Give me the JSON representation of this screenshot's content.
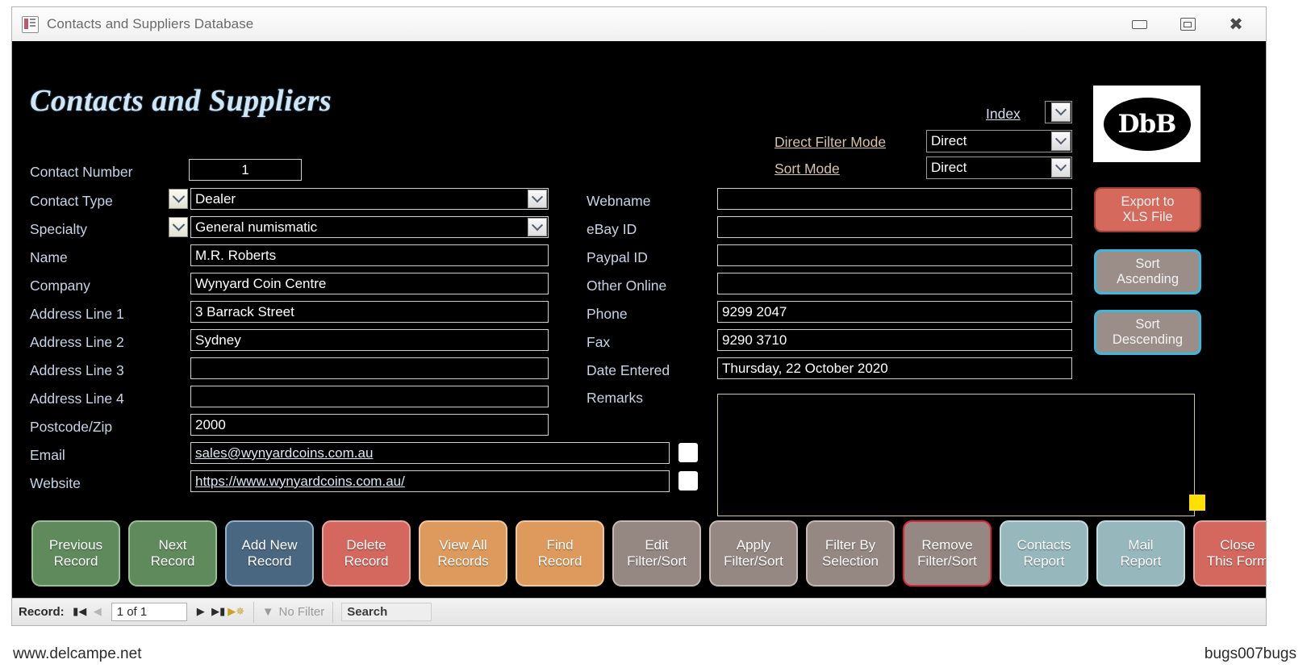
{
  "window": {
    "title": "Contacts and Suppliers Database",
    "icon": "access-form-icon",
    "controls": {
      "minimize": "–",
      "restore": "▣",
      "close": "✕"
    }
  },
  "form": {
    "title": "Contacts and Suppliers",
    "logo_text": "DbB",
    "top_controls": {
      "index_label": "Index",
      "index_value": "",
      "direct_filter_mode_label": "Direct Filter Mode",
      "direct_filter_mode_value": "Direct",
      "sort_mode_label": "Sort Mode",
      "sort_mode_value": "Direct"
    },
    "left_fields": [
      {
        "label": "Contact Number",
        "value": "1",
        "type": "number"
      },
      {
        "label": "Contact Type",
        "value": "Dealer",
        "type": "combo"
      },
      {
        "label": "Specialty",
        "value": "General numismatic",
        "type": "combo"
      },
      {
        "label": "Name",
        "value": "M.R. Roberts",
        "type": "text"
      },
      {
        "label": "Company",
        "value": "Wynyard Coin Centre",
        "type": "text"
      },
      {
        "label": "Address Line 1",
        "value": "3 Barrack Street",
        "type": "text"
      },
      {
        "label": "Address Line 2",
        "value": "Sydney",
        "type": "text"
      },
      {
        "label": "Address Line 3",
        "value": "",
        "type": "text"
      },
      {
        "label": "Address Line 4",
        "value": "",
        "type": "text"
      },
      {
        "label": "Postcode/Zip",
        "value": "2000",
        "type": "text"
      },
      {
        "label": "Email",
        "value": "sales@wynyardcoins.com.au",
        "type": "link"
      },
      {
        "label": "Website",
        "value": "https://www.wynyardcoins.com.au/",
        "type": "link"
      }
    ],
    "right_fields": [
      {
        "label": "Webname",
        "value": "",
        "type": "text"
      },
      {
        "label": "eBay ID",
        "value": "",
        "type": "text"
      },
      {
        "label": "Paypal ID",
        "value": "",
        "type": "text"
      },
      {
        "label": "Other Online",
        "value": "",
        "type": "text"
      },
      {
        "label": "Phone",
        "value": "9299 2047",
        "type": "text"
      },
      {
        "label": "Fax",
        "value": "9290 3710",
        "type": "text"
      },
      {
        "label": "Date Entered",
        "value": "Thursday, 22 October 2020",
        "type": "text"
      },
      {
        "label": "Remarks",
        "value": "",
        "type": "memo"
      }
    ],
    "side_buttons": [
      {
        "line1": "Export to",
        "line2": "XLS File",
        "fill": "#d4695c",
        "border": "#9b3f36"
      },
      {
        "line1": "Sort",
        "line2": "Ascending",
        "fill": "#9b8d88",
        "border": "#3ab9e0"
      },
      {
        "line1": "Sort",
        "line2": "Descending",
        "fill": "#9b8d88",
        "border": "#3ab9e0"
      }
    ],
    "bottom_buttons": [
      {
        "line1": "Previous",
        "line2": "Record",
        "fill": "#5f8a5c",
        "border": "#9bbf98"
      },
      {
        "line1": "Next",
        "line2": "Record",
        "fill": "#5f8a5c",
        "border": "#9bbf98"
      },
      {
        "line1": "Add New",
        "line2": "Record",
        "fill": "#4a6781",
        "border": "#8fb3cc"
      },
      {
        "line1": "Delete",
        "line2": "Record",
        "fill": "#d4685e",
        "border": "#e7a49d"
      },
      {
        "line1": "View All",
        "line2": "Records",
        "fill": "#dd9a5c",
        "border": "#f0c79a"
      },
      {
        "line1": "Find",
        "line2": "Record",
        "fill": "#dd9a5c",
        "border": "#f0c79a"
      },
      {
        "line1": "Edit",
        "line2": "Filter/Sort",
        "fill": "#958781",
        "border": "#c5b8b3"
      },
      {
        "line1": "Apply",
        "line2": "Filter/Sort",
        "fill": "#958781",
        "border": "#c5b8b3"
      },
      {
        "line1": "Filter By",
        "line2": "Selection",
        "fill": "#958781",
        "border": "#c5b8b3"
      },
      {
        "line1": "Remove",
        "line2": "Filter/Sort",
        "fill": "#958781",
        "border": "#e0213a"
      },
      {
        "line1": "Contacts",
        "line2": "Report",
        "fill": "#96b7bc",
        "border": "#c2dade"
      },
      {
        "line1": "Mail",
        "line2": "Report",
        "fill": "#96b7bc",
        "border": "#c2dade"
      },
      {
        "line1": "Close",
        "line2": "This Form",
        "fill": "#d4685e",
        "border": "#e7a49d"
      }
    ]
  },
  "statusbar": {
    "record_label": "Record:",
    "first_icon": "first-record-icon",
    "prev_icon": "previous-record-icon",
    "position": "1 of 1",
    "next_icon": "next-record-icon",
    "last_icon": "last-record-icon",
    "new_icon": "new-record-icon",
    "filter_icon": "filter-icon",
    "filter_text": "No Filter",
    "search_placeholder": "Search"
  },
  "watermarks": {
    "left": "www.delcampe.net",
    "right": "bugs007bugs"
  },
  "colors": {
    "form_bg": "#000000",
    "label_blue": "#c6d4e8",
    "label_tan": "#d8c3a5",
    "title_blue": "#cfe6f7",
    "flag_yellow": "#ffe000"
  }
}
